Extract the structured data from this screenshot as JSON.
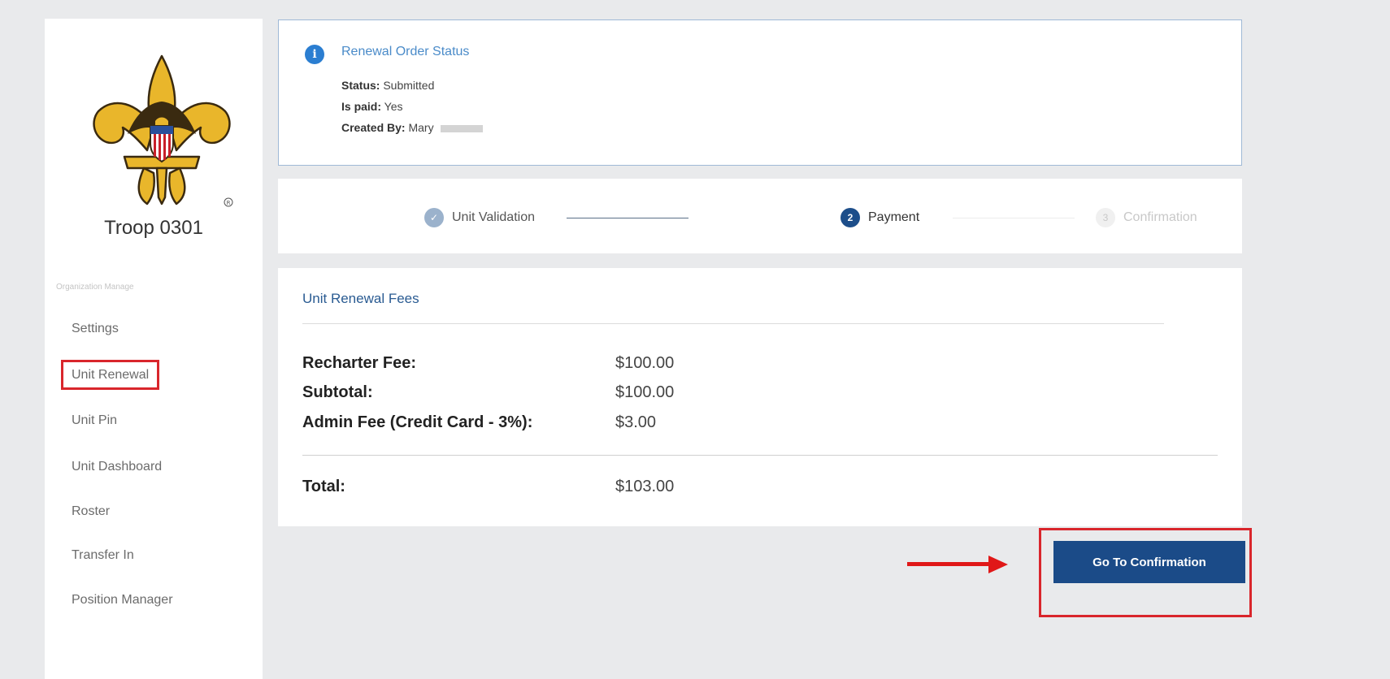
{
  "sidebar": {
    "troop_name": "Troop 0301",
    "section_label": "Organization Manage",
    "items": [
      {
        "label": "Settings"
      },
      {
        "label": "Unit Renewal"
      },
      {
        "label": "Unit Pin"
      },
      {
        "label": "Unit Dashboard"
      },
      {
        "label": "Roster"
      },
      {
        "label": "Transfer In"
      },
      {
        "label": "Position Manager"
      }
    ]
  },
  "status_card": {
    "title": "Renewal Order Status",
    "status_label": "Status:",
    "status_value": "Submitted",
    "paid_label": "Is paid:",
    "paid_value": "Yes",
    "created_label": "Created By:",
    "created_value": "Mary"
  },
  "stepper": {
    "steps": [
      {
        "number": "✓",
        "label": "Unit Validation",
        "state": "done"
      },
      {
        "number": "2",
        "label": "Payment",
        "state": "current"
      },
      {
        "number": "3",
        "label": "Confirmation",
        "state": "pending"
      }
    ]
  },
  "fees": {
    "title": "Unit Renewal Fees",
    "rows": [
      {
        "label": "Recharter Fee:",
        "value": "$100.00"
      },
      {
        "label": "Subtotal:",
        "value": "$100.00"
      },
      {
        "label": "Admin Fee (Credit Card - 3%):",
        "value": "$3.00"
      }
    ],
    "total_label": "Total:",
    "total_value": "$103.00"
  },
  "actions": {
    "confirm_label": "Go To Confirmation"
  },
  "colors": {
    "primary": "#1b4b88",
    "highlight": "#d9262c",
    "info": "#2b7ed1"
  }
}
